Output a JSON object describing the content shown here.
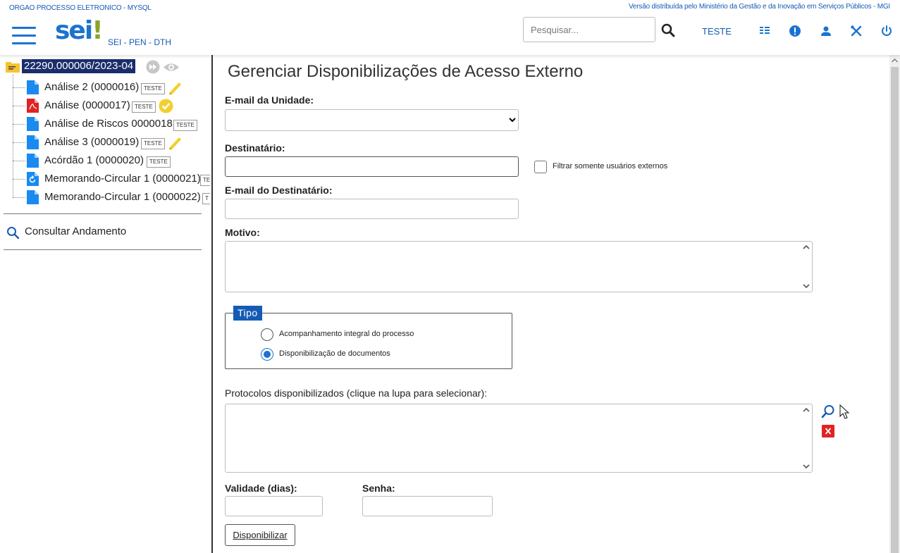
{
  "header": {
    "org_name": "ORGAO PROCESSO ELETRONICO - MYSQL",
    "distribution_note": "Versão distribuída pelo Ministério da Gestão e da Inovação em Serviços Públicos - MGI",
    "logo_text": "sei",
    "logo_mark": "!",
    "subtitle": "SEI - PEN - DTH",
    "search_placeholder": "Pesquisar...",
    "unit_label": "TESTE",
    "icons": [
      "menu-icon",
      "search-icon",
      "grid-icon",
      "info-icon",
      "user-icon",
      "tools-icon",
      "power-icon"
    ]
  },
  "tree": {
    "process_number": "22290.000006/2023-04",
    "items": [
      {
        "label": "Análise 2 (0000016)",
        "badge": "TESTE",
        "icon": "document-icon",
        "extra": "pen-icon"
      },
      {
        "label": "Análise (0000017)",
        "badge": "TESTE",
        "icon": "pdf-icon",
        "extra": "signed-seal-icon"
      },
      {
        "label": "Análise de Riscos 0000018",
        "badge": "TESTE",
        "icon": "document-icon",
        "extra": ""
      },
      {
        "label": "Análise 3 (0000019)",
        "badge": "TESTE",
        "icon": "document-icon",
        "extra": "pen-icon"
      },
      {
        "label": "Acórdão 1 (0000020)",
        "badge": "TESTE",
        "icon": "document-icon",
        "extra": ""
      },
      {
        "label": "Memorando-Circular 1 (0000021)",
        "badge": "TE",
        "icon": "document-sync-icon",
        "extra": ""
      },
      {
        "label": "Memorando-Circular 1 (0000022)",
        "badge": "T",
        "icon": "document-icon",
        "extra": ""
      }
    ],
    "consult_label": "Consultar Andamento"
  },
  "form": {
    "title": "Gerenciar Disponibilizações de Acesso Externo",
    "email_unit_label": "E-mail da Unidade",
    "recipient_label": "Destinatário",
    "filter_external_label": "Filtrar somente usuários externos",
    "recipient_email_label": "E-mail do Destinatário",
    "reason_label": "Motivo",
    "type_legend": "Tipo",
    "type_options": [
      "Acompanhamento integral do processo",
      "Disponibilização de documentos"
    ],
    "type_selected": "Disponibilização de documentos",
    "protocols_label": "Protocolos disponibilizados (clique na lupa para selecionar):",
    "validity_label": "Validade (dias)",
    "password_label": "Senha",
    "submit_label": "Disponibilizar",
    "colors": {
      "primary": "#155bb5",
      "accent": "#1a73d0",
      "remove": "#e02323",
      "process_bg": "#1a2d6b"
    }
  }
}
